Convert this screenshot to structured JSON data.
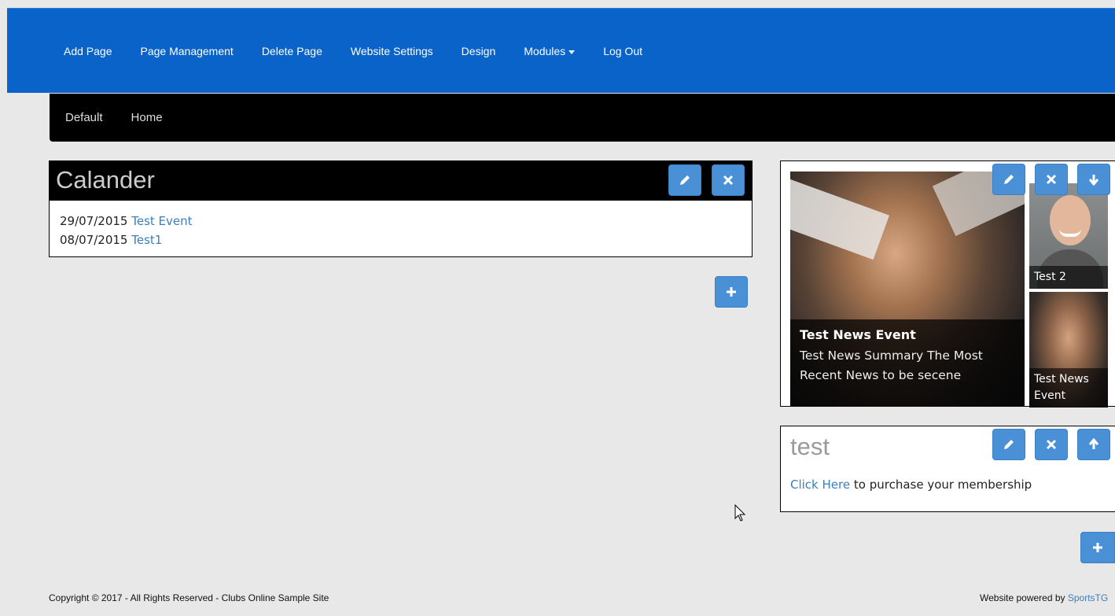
{
  "topnav": {
    "items": [
      "Add Page",
      "Page Management",
      "Delete Page",
      "Website Settings",
      "Design",
      "Modules",
      "Log Out"
    ]
  },
  "subnav": {
    "items": [
      "Default",
      "Home"
    ]
  },
  "calendar": {
    "title": "Calander",
    "events": [
      {
        "date": "29/07/2015",
        "name": "Test Event"
      },
      {
        "date": "08/07/2015",
        "name": "Test1"
      }
    ]
  },
  "news": {
    "main_title": "Test News Event",
    "main_summary": "Test News Summary The Most Recent News to be secene",
    "thumb1_caption": "Test 2",
    "thumb2_caption": "Test News Event"
  },
  "test_box": {
    "title": "test",
    "link_text": "Click Here",
    "text": "to purchase your membership"
  },
  "footer": {
    "copyright": "Copyright © 2017 - All Rights Reserved - Clubs Online Sample Site",
    "powered_prefix": "Website powered by",
    "powered_link": "SportsTG"
  },
  "colors": {
    "topbar": "#0a63c8",
    "button": "#4a90d6",
    "link": "#3a7fc1"
  },
  "icons": {
    "edit": "pencil-icon",
    "delete": "close-icon",
    "move_down": "arrow-down-icon",
    "move_up": "arrow-up-icon",
    "add": "plus-icon"
  }
}
